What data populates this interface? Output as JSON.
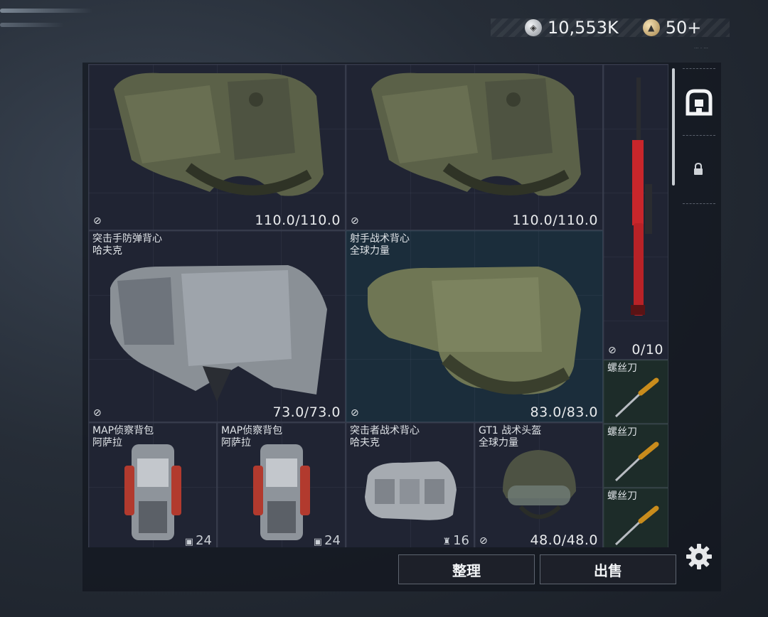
{
  "currency": {
    "silver_amount": "10,553K",
    "gold_amount": "50+",
    "silver_icon": "silver-coin-icon",
    "gold_icon": "gold-coin-icon"
  },
  "items": [
    {
      "id": "vest-1",
      "name_line1": "",
      "name_line2": "",
      "durability": "110.0/110.0"
    },
    {
      "id": "vest-2",
      "name_line1": "",
      "name_line2": "",
      "durability": "110.0/110.0"
    },
    {
      "id": "sniper-rifle",
      "name_line1": "",
      "name_line2": "",
      "durability": "0/10"
    },
    {
      "id": "assault-vest",
      "name_line1": "突击手防弹背心",
      "name_line2": "哈夫克",
      "durability": "73.0/73.0"
    },
    {
      "id": "marksman-vest",
      "name_line1": "射手战术背心",
      "name_line2": "全球力量",
      "durability": "83.0/83.0"
    },
    {
      "id": "screwdriver-1",
      "name_line1": "螺丝刀",
      "name_line2": ""
    },
    {
      "id": "screwdriver-2",
      "name_line1": "螺丝刀",
      "name_line2": ""
    },
    {
      "id": "screwdriver-3",
      "name_line1": "螺丝刀",
      "name_line2": ""
    },
    {
      "id": "map-backpack-1",
      "name_line1": "MAP侦察背包",
      "name_line2": "阿萨拉",
      "count": "24"
    },
    {
      "id": "map-backpack-2",
      "name_line1": "MAP侦察背包",
      "name_line2": "阿萨拉",
      "count": "24"
    },
    {
      "id": "assault-chest-rig",
      "name_line1": "突击者战术背心",
      "name_line2": "哈夫克",
      "count": "16"
    },
    {
      "id": "gt1-helmet",
      "name_line1": "GT1 战术头盔",
      "name_line2": "全球力量",
      "durability": "48.0/48.0"
    }
  ],
  "buttons": {
    "sort": "整理",
    "sell": "出售"
  },
  "icons": {
    "storage": "storage-icon",
    "lock": "lock-icon",
    "settings": "gear-icon",
    "not_insured": "uninsured-icon"
  },
  "colors": {
    "accent_teal": "#1b2d3b",
    "accent_green": "#1d2c29",
    "rifle_red": "#c8262b"
  }
}
